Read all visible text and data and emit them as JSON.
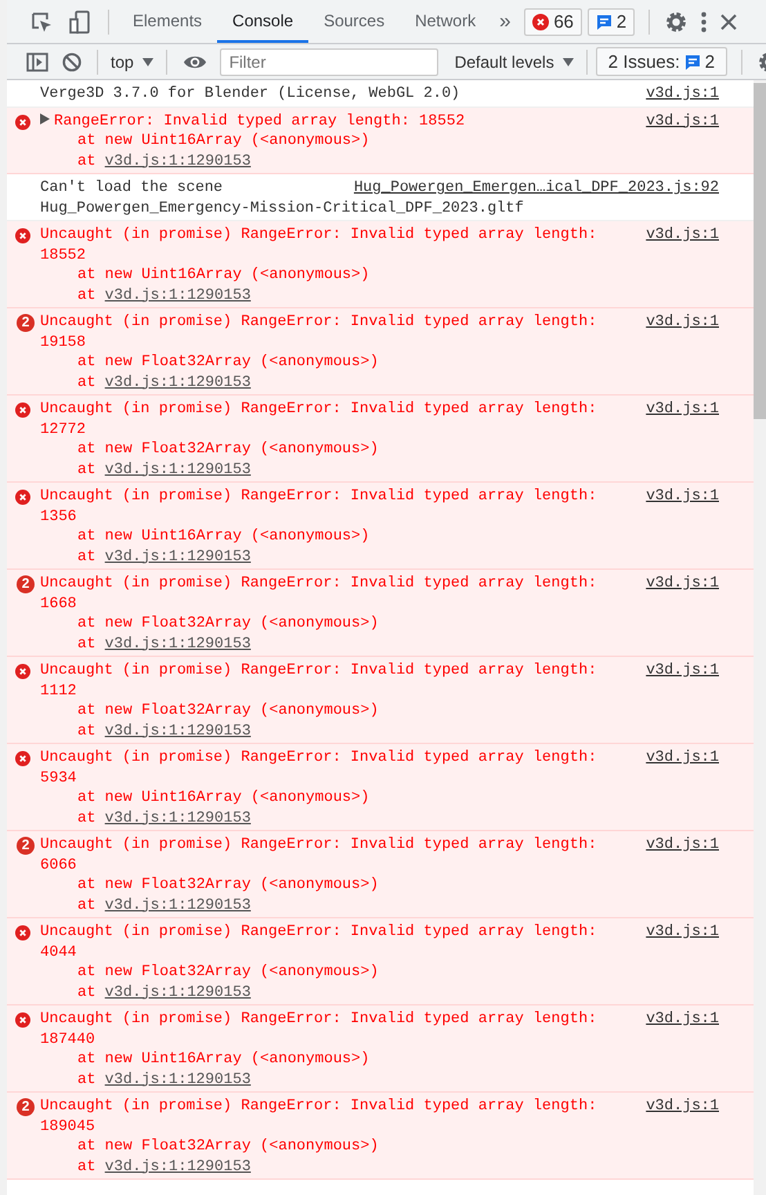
{
  "toolbar": {
    "tabs": [
      {
        "label": "Elements",
        "selected": false
      },
      {
        "label": "Console",
        "selected": true
      },
      {
        "label": "Sources",
        "selected": false
      },
      {
        "label": "Network",
        "selected": false
      }
    ],
    "more": "»",
    "error_count": "66",
    "message_count": "2"
  },
  "console_toolbar": {
    "context": "top",
    "filter": {
      "placeholder": "Filter"
    },
    "levels": "Default levels",
    "issues": {
      "label": "2 Issues:",
      "count": "2"
    }
  },
  "messages": [
    {
      "kind": "info",
      "text": "Verge3D 3.7.0 for Blender (License, WebGL 2.0)",
      "source": "v3d.js:1"
    },
    {
      "kind": "error",
      "expandable": true,
      "text": "RangeError: Invalid typed array length: 18552",
      "stack": [
        {
          "text": "at new Uint16Array (<anonymous>)"
        },
        {
          "text": "at",
          "link": "v3d.js:1:1290153"
        }
      ],
      "source": "v3d.js:1"
    },
    {
      "kind": "info",
      "text": "Can't load the scene",
      "detail": "Hug_Powergen_Emergency-Mission-Critical_DPF_2023.gltf",
      "source": "Hug_Powergen_Emergen…ical_DPF_2023.js:92"
    },
    {
      "kind": "error",
      "text": "Uncaught (in promise) RangeError: Invalid typed array length: 18552",
      "stack": [
        {
          "text": "at new Uint16Array (<anonymous>)"
        },
        {
          "text": "at",
          "link": "v3d.js:1:1290153"
        }
      ],
      "source": "v3d.js:1"
    },
    {
      "kind": "error",
      "count": "2",
      "text": "Uncaught (in promise) RangeError: Invalid typed array length: 19158",
      "stack": [
        {
          "text": "at new Float32Array (<anonymous>)"
        },
        {
          "text": "at",
          "link": "v3d.js:1:1290153"
        }
      ],
      "source": "v3d.js:1"
    },
    {
      "kind": "error",
      "text": "Uncaught (in promise) RangeError: Invalid typed array length: 12772",
      "stack": [
        {
          "text": "at new Float32Array (<anonymous>)"
        },
        {
          "text": "at",
          "link": "v3d.js:1:1290153"
        }
      ],
      "source": "v3d.js:1"
    },
    {
      "kind": "error",
      "text": "Uncaught (in promise) RangeError: Invalid typed array length: 1356",
      "stack": [
        {
          "text": "at new Uint16Array (<anonymous>)"
        },
        {
          "text": "at",
          "link": "v3d.js:1:1290153"
        }
      ],
      "source": "v3d.js:1"
    },
    {
      "kind": "error",
      "count": "2",
      "text": "Uncaught (in promise) RangeError: Invalid typed array length: 1668",
      "stack": [
        {
          "text": "at new Float32Array (<anonymous>)"
        },
        {
          "text": "at",
          "link": "v3d.js:1:1290153"
        }
      ],
      "source": "v3d.js:1"
    },
    {
      "kind": "error",
      "text": "Uncaught (in promise) RangeError: Invalid typed array length: 1112",
      "stack": [
        {
          "text": "at new Float32Array (<anonymous>)"
        },
        {
          "text": "at",
          "link": "v3d.js:1:1290153"
        }
      ],
      "source": "v3d.js:1"
    },
    {
      "kind": "error",
      "text": "Uncaught (in promise) RangeError: Invalid typed array length: 5934",
      "stack": [
        {
          "text": "at new Uint16Array (<anonymous>)"
        },
        {
          "text": "at",
          "link": "v3d.js:1:1290153"
        }
      ],
      "source": "v3d.js:1"
    },
    {
      "kind": "error",
      "count": "2",
      "text": "Uncaught (in promise) RangeError: Invalid typed array length: 6066",
      "stack": [
        {
          "text": "at new Float32Array (<anonymous>)"
        },
        {
          "text": "at",
          "link": "v3d.js:1:1290153"
        }
      ],
      "source": "v3d.js:1"
    },
    {
      "kind": "error",
      "text": "Uncaught (in promise) RangeError: Invalid typed array length: 4044",
      "stack": [
        {
          "text": "at new Float32Array (<anonymous>)"
        },
        {
          "text": "at",
          "link": "v3d.js:1:1290153"
        }
      ],
      "source": "v3d.js:1"
    },
    {
      "kind": "error",
      "text": "Uncaught (in promise) RangeError: Invalid typed array length: 187440",
      "stack": [
        {
          "text": "at new Uint16Array (<anonymous>)"
        },
        {
          "text": "at",
          "link": "v3d.js:1:1290153"
        }
      ],
      "source": "v3d.js:1"
    },
    {
      "kind": "error",
      "count": "2",
      "text": "Uncaught (in promise) RangeError: Invalid typed array length: 189045",
      "stack": [
        {
          "text": "at new Float32Array (<anonymous>)"
        },
        {
          "text": "at",
          "link": "v3d.js:1:1290153"
        }
      ],
      "source": "v3d.js:1"
    }
  ]
}
